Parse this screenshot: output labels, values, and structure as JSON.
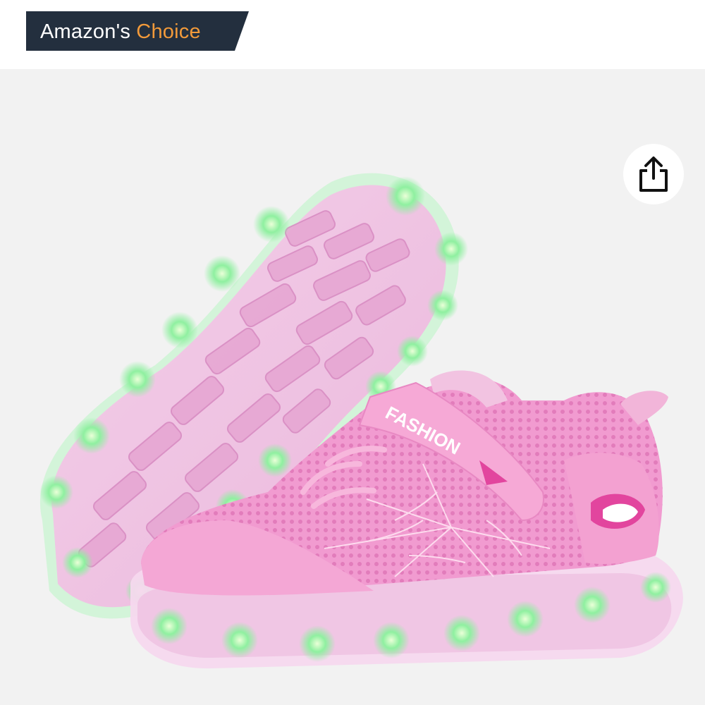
{
  "badge": {
    "brand": "Amazon's",
    "label": "Choice",
    "background_color": "#232f3e",
    "accent_color": "#f29a3a"
  },
  "product_image": {
    "sneaker_strap_text": "FASHION",
    "icon": "share-icon"
  }
}
